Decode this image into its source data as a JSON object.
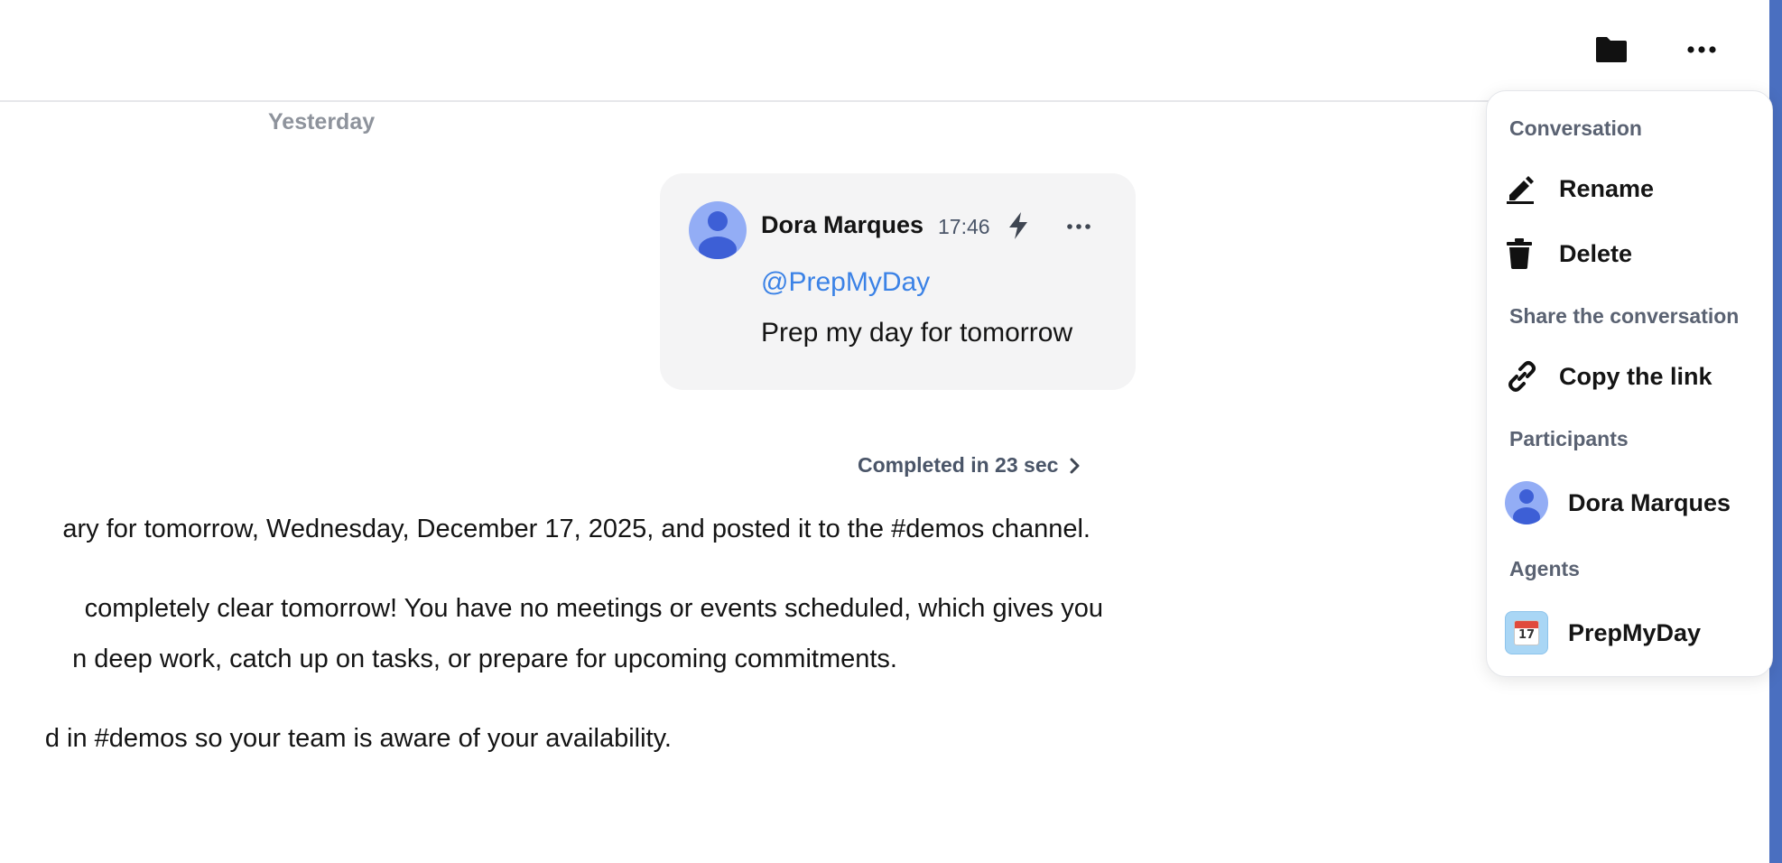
{
  "day_separator": "Yesterday",
  "message": {
    "sender": "Dora Marques",
    "time": "17:46",
    "mention": "@PrepMyDay",
    "text": "Prep my day for tomorrow"
  },
  "completion": {
    "label": "Completed in 23 sec"
  },
  "response": {
    "lines": [
      "ary for tomorrow, Wednesday, December 17, 2025, and posted it to the #demos channel.",
      "completely clear tomorrow! You have no meetings or events scheduled, which gives you",
      "n deep work, catch up on tasks, or prepare for upcoming commitments.",
      "d in #demos so your team is aware of your availability."
    ]
  },
  "menu": {
    "conversation_heading": "Conversation",
    "rename": "Rename",
    "delete": "Delete",
    "share_heading": "Share the conversation",
    "copy_link": "Copy the link",
    "participants_heading": "Participants",
    "participant_name": "Dora Marques",
    "agents_heading": "Agents",
    "agent_name": "PrepMyDay",
    "agent_icon_day": "17"
  },
  "icons": {
    "folder": "folder-icon",
    "more": "more-horizontal-icon",
    "bolt": "lightning-icon",
    "pencil": "pencil-icon",
    "trash": "trash-icon",
    "link": "link-icon",
    "chevron": "chevron-right-icon"
  },
  "colors": {
    "mention": "#3b82e6",
    "avatar_bg": "#93adf5",
    "avatar_fg": "#3d5fd6",
    "bubble_bg": "#f4f4f5",
    "side_strip": "#4a6fc0"
  }
}
